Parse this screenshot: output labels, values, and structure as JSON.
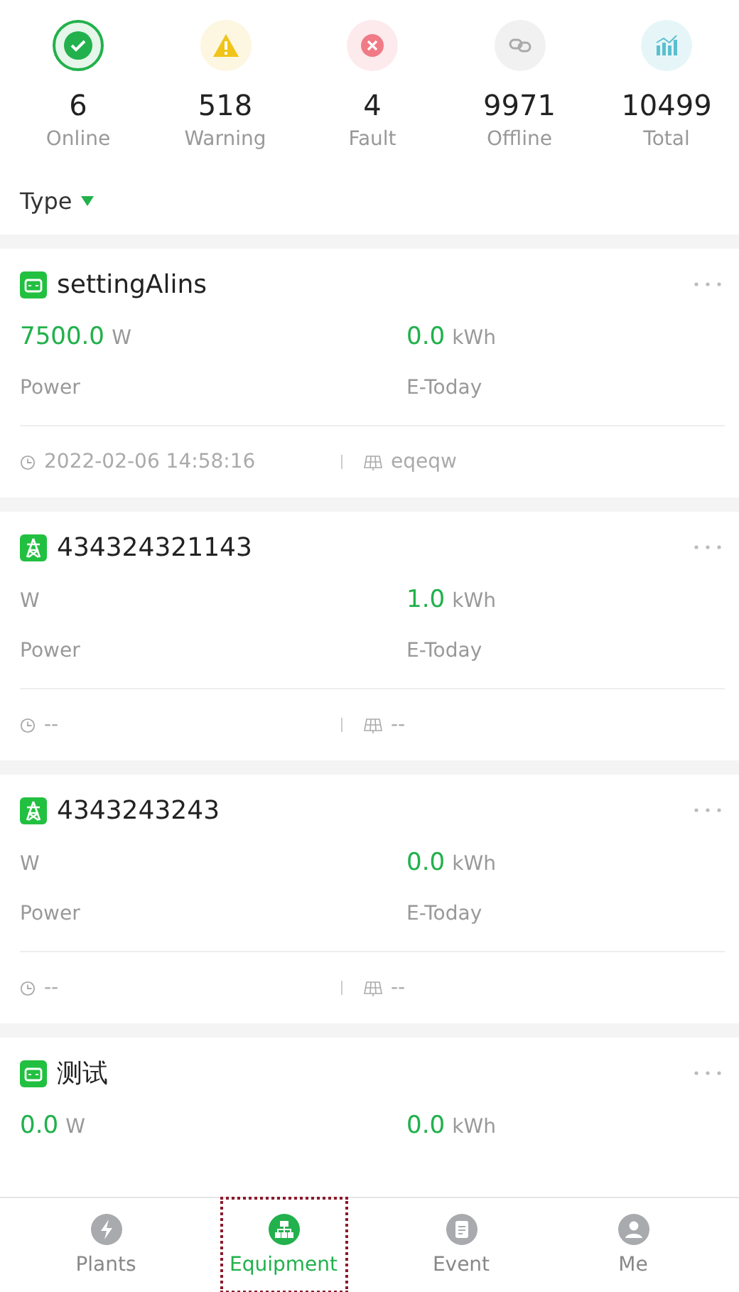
{
  "stats": [
    {
      "kind": "online",
      "count": "6",
      "label": "Online",
      "selected": true
    },
    {
      "kind": "warning",
      "count": "518",
      "label": "Warning",
      "selected": false
    },
    {
      "kind": "fault",
      "count": "4",
      "label": "Fault",
      "selected": false
    },
    {
      "kind": "offline",
      "count": "9971",
      "label": "Offline",
      "selected": false
    },
    {
      "kind": "total",
      "count": "10499",
      "label": "Total",
      "selected": false
    }
  ],
  "filter": {
    "label": "Type"
  },
  "devices": [
    {
      "kind": "battery",
      "name": "settingAlins",
      "power": {
        "value": "7500.0",
        "unit": "W",
        "label": "Power"
      },
      "energy": {
        "value": "0.0",
        "unit": "kWh",
        "label": "E-Today"
      },
      "time": "2022-02-06 14:58:16",
      "plant": "eqeqw"
    },
    {
      "kind": "tower",
      "name": "434324321143",
      "power": {
        "unit": "W",
        "label": "Power"
      },
      "energy": {
        "value": "1.0",
        "unit": "kWh",
        "label": "E-Today"
      },
      "time": "--",
      "plant": "--"
    },
    {
      "kind": "tower",
      "name": "4343243243",
      "power": {
        "unit": "W",
        "label": "Power"
      },
      "energy": {
        "value": "0.0",
        "unit": "kWh",
        "label": "E-Today"
      },
      "time": "--",
      "plant": "--"
    },
    {
      "kind": "battery",
      "name": "测试",
      "power": {
        "value": "0.0",
        "unit": "W"
      },
      "energy": {
        "value": "0.0",
        "unit": "kWh"
      }
    }
  ],
  "nav": [
    {
      "kind": "plants",
      "label": "Plants",
      "selected": false
    },
    {
      "kind": "equipment",
      "label": "Equipment",
      "selected": true
    },
    {
      "kind": "event",
      "label": "Event",
      "selected": false
    },
    {
      "kind": "me",
      "label": "Me",
      "selected": false
    }
  ]
}
